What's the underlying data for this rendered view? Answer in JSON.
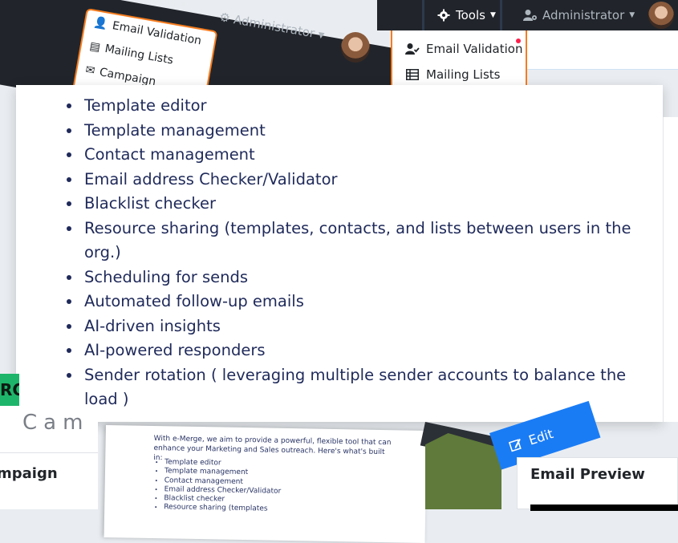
{
  "navbar": {
    "tools_label": "Tools",
    "admin_label": "Administrator",
    "bg_color": "#21252b",
    "accent_color": "#f57c1f"
  },
  "dropdown": {
    "items": [
      {
        "label": "Email Validation",
        "icon": "user-check-icon",
        "badge": true
      },
      {
        "label": "Mailing Lists",
        "icon": "table-list-icon"
      }
    ]
  },
  "bg_screenshot": {
    "tools_label": "Tools",
    "admin_label": "Administrator",
    "items": [
      "Email Validation",
      "Mailing Lists",
      "Campaign"
    ]
  },
  "features": [
    "Template editor",
    "Template management",
    "Contact management",
    "Email address Checker/Validator",
    "Blacklist checker",
    "Resource sharing (templates, contacts, and lists between users in the org.)",
    "Scheduling for sends",
    "Automated follow-up emails",
    "AI-driven insights",
    "AI-powered responders",
    "Sender rotation ( leveraging multiple sender accounts to balance the load )"
  ],
  "lower": {
    "badge_text": "RC",
    "page_heading": "Cam",
    "campaign_header": "mpaign",
    "edit_label": "Edit",
    "email_preview_title": "Email Preview",
    "mini_doc": {
      "intro": "With e-Merge, we aim to provide a powerful, flexible tool that can enhance your Marketing and Sales outreach. Here's what's built in:",
      "items": [
        "Template editor",
        "Template management",
        "Contact management",
        "Email address Checker/Validator",
        "Blacklist checker",
        "Resource sharing (templates"
      ]
    }
  }
}
